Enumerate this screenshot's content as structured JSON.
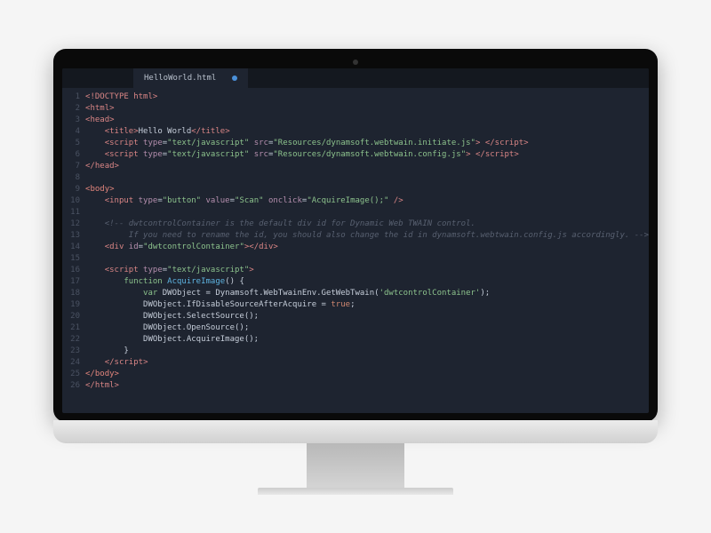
{
  "tab": {
    "filename": "HelloWorld.html"
  },
  "lineNumbers": [
    "1",
    "2",
    "3",
    "4",
    "5",
    "6",
    "7",
    "8",
    "9",
    "10",
    "11",
    "12",
    "13",
    "14",
    "15",
    "16",
    "17",
    "18",
    "19",
    "20",
    "21",
    "22",
    "23",
    "24",
    "25",
    "26"
  ],
  "code": {
    "l1": {
      "a": "<",
      "b": "!DOCTYPE html",
      "c": ">"
    },
    "l2": {
      "a": "<",
      "b": "html",
      "c": ">"
    },
    "l3": {
      "a": "<",
      "b": "head",
      "c": ">"
    },
    "l4": {
      "o1": "<",
      "t1": "title",
      "c1": ">",
      "txt": "Hello World",
      "o2": "</",
      "t2": "title",
      "c2": ">"
    },
    "l5": {
      "o": "<",
      "t": "script",
      "a1": " type",
      "eq1": "=",
      "v1": "\"text/javascript\"",
      "a2": " src",
      "eq2": "=",
      "v2": "\"Resources/dynamsoft.webtwain.initiate.js\"",
      "c": ">",
      "sp": " ",
      "o2": "</",
      "t2": "script",
      "c2": ">"
    },
    "l6": {
      "o": "<",
      "t": "script",
      "a1": " type",
      "eq1": "=",
      "v1": "\"text/javascript\"",
      "a2": " src",
      "eq2": "=",
      "v2": "\"Resources/dynamsoft.webtwain.config.js\"",
      "c": ">",
      "sp": " ",
      "o2": "</",
      "t2": "script",
      "c2": ">"
    },
    "l7": {
      "a": "</",
      "b": "head",
      "c": ">"
    },
    "l9": {
      "a": "<",
      "b": "body",
      "c": ">"
    },
    "l10": {
      "o": "<",
      "t": "input",
      "a1": " type",
      "eq1": "=",
      "v1": "\"button\"",
      "a2": " value",
      "eq2": "=",
      "v2": "\"Scan\"",
      "a3": " onclick",
      "eq3": "=",
      "v3": "\"AcquireImage();\"",
      "c": " />"
    },
    "l12": "<!-- dwtcontrolContainer is the default div id for Dynamic Web TWAIN control.",
    "l13": "     If you need to rename the id, you should also change the id in dynamsoft.webtwain.config.js accordingly. -->",
    "l14": {
      "o": "<",
      "t": "div",
      "a": " id",
      "eq": "=",
      "v": "\"dwtcontrolContainer\"",
      "c": ">",
      "o2": "</",
      "t2": "div",
      "c2": ">"
    },
    "l16": {
      "o": "<",
      "t": "script",
      "a": " type",
      "eq": "=",
      "v": "\"text/javascript\"",
      "c": ">"
    },
    "l17": {
      "k": "function",
      "sp": " ",
      "fn": "AcquireImage",
      "p": "() {"
    },
    "l18": {
      "k": "var",
      "rest": " DWObject = Dynamsoft.WebTwainEnv.GetWebTwain(",
      "s": "'dwtcontrolContainer'",
      "end": ");"
    },
    "l19": {
      "a": "DWObject.IfDisableSourceAfterAcquire = ",
      "b": "true",
      "c": ";"
    },
    "l20": "DWObject.SelectSource();",
    "l21": "DWObject.OpenSource();",
    "l22": "DWObject.AcquireImage();",
    "l23": "}",
    "l24": {
      "a": "</",
      "b": "script",
      "c": ">"
    },
    "l25": {
      "a": "</",
      "b": "body",
      "c": ">"
    },
    "l26": {
      "a": "</",
      "b": "html",
      "c": ">"
    }
  }
}
